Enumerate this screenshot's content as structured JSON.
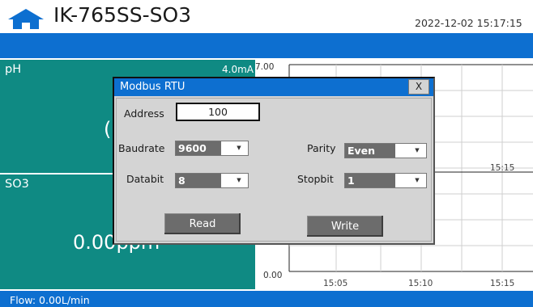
{
  "header": {
    "title": "IK-765SS-SO3",
    "datetime": "2022-12-02 15:17:15",
    "home_icon": "home-icon",
    "accent_color": "#0d6fd0"
  },
  "panels": {
    "ph": {
      "name": "pH",
      "current": "4.0mA",
      "value_partial": "("
    },
    "so3": {
      "name": "SO3",
      "value": "0.00ppm"
    },
    "panel_color": "#0f8a83"
  },
  "chart_data": {
    "type": "line",
    "y_tick_labels": [
      "7.00",
      "0.00"
    ],
    "x_tick_labels": [
      "15:05",
      "15:10",
      "15:15"
    ],
    "inner_x_label": "15:15",
    "grid": true,
    "series": []
  },
  "flow": {
    "label": "Flow:",
    "value": "0.00L/min"
  },
  "dialog": {
    "title": "Modbus RTU",
    "close_label": "X",
    "address_label": "Address",
    "address_value": "100",
    "baudrate_label": "Baudrate",
    "baudrate_value": "9600",
    "parity_label": "Parity",
    "parity_value": "Even",
    "databit_label": "Databit",
    "databit_value": "8",
    "stopbit_label": "Stopbit",
    "stopbit_value": "1",
    "arrow_glyph": "▼",
    "read_label": "Read",
    "write_label": "Write"
  }
}
